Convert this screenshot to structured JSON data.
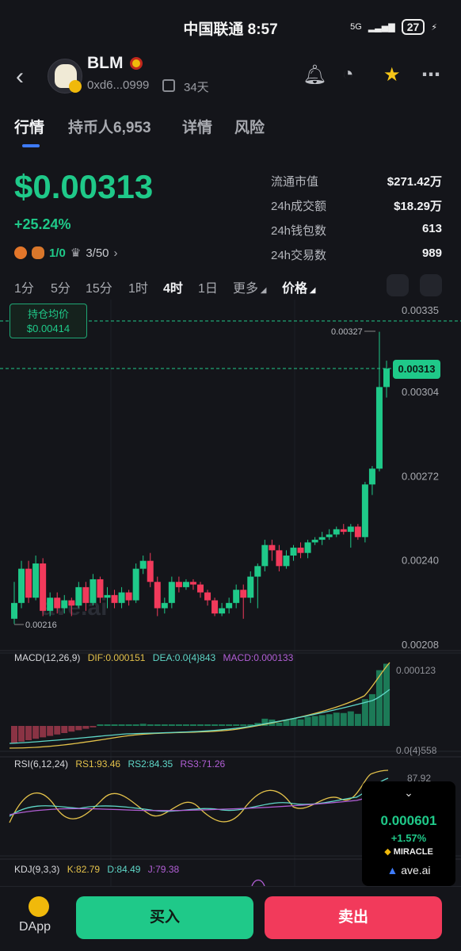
{
  "status": {
    "carrier_time": "中国联通 8:57",
    "network": "5G",
    "battery": "27"
  },
  "header": {
    "token": "BLM",
    "address": "0xd6...0999",
    "age": "34天"
  },
  "tabs": [
    "行情",
    "持币人6,953",
    "详情",
    "风险"
  ],
  "price": {
    "value": "$0.00313",
    "change": "+25.24%"
  },
  "tags": {
    "holders": "1/0",
    "rank": "3/50"
  },
  "stats": [
    {
      "label": "流通市值",
      "value": "$271.42万"
    },
    {
      "label": "24h成交额",
      "value": "$18.29万"
    },
    {
      "label": "24h钱包数",
      "value": "613"
    },
    {
      "label": "24h交易数",
      "value": "989"
    }
  ],
  "timeframes": [
    "1分",
    "5分",
    "15分",
    "1时",
    "4时",
    "1日",
    "更多",
    "价格"
  ],
  "active_timeframe": "4时",
  "chart": {
    "avg_label": "持仓均价",
    "avg_value": "$0.00414",
    "current_tag": "0.00313",
    "high_label": "0.00327",
    "low_label": "0.00216",
    "watermark": "ave.ai"
  },
  "chart_data": {
    "type": "candlestick",
    "y_ticks": [
      "0.00335",
      "0.00304",
      "0.00272",
      "0.00240",
      "0.00208"
    ],
    "ylim": [
      0.00208,
      0.00335
    ],
    "candles": [
      [
        0.00218,
        0.00224,
        0.00232,
        0.00216
      ],
      [
        0.00224,
        0.00237,
        0.0024,
        0.00222
      ],
      [
        0.00237,
        0.00226,
        0.0024,
        0.00224
      ],
      [
        0.00226,
        0.00239,
        0.00242,
        0.00225
      ],
      [
        0.00239,
        0.00221,
        0.00241,
        0.00219
      ],
      [
        0.00221,
        0.00226,
        0.00228,
        0.00219
      ],
      [
        0.00226,
        0.00222,
        0.00228,
        0.0022
      ],
      [
        0.00222,
        0.00225,
        0.00227,
        0.0022
      ],
      [
        0.00225,
        0.00223,
        0.00226,
        0.00219
      ],
      [
        0.00223,
        0.0023,
        0.00232,
        0.00222
      ],
      [
        0.0023,
        0.00224,
        0.00232,
        0.00221
      ],
      [
        0.00224,
        0.00233,
        0.00235,
        0.00223
      ],
      [
        0.00233,
        0.00226,
        0.00234,
        0.00224
      ],
      [
        0.00226,
        0.00227,
        0.0023,
        0.00222
      ],
      [
        0.00227,
        0.00224,
        0.00229,
        0.00222
      ],
      [
        0.00224,
        0.00228,
        0.0023,
        0.00222
      ],
      [
        0.00228,
        0.00225,
        0.00229,
        0.00223
      ],
      [
        0.00225,
        0.00237,
        0.00239,
        0.00224
      ],
      [
        0.00237,
        0.0024,
        0.00242,
        0.00235
      ],
      [
        0.0024,
        0.00232,
        0.00243,
        0.0023
      ],
      [
        0.00232,
        0.00222,
        0.00234,
        0.00219
      ],
      [
        0.00222,
        0.00224,
        0.00226,
        0.0022
      ],
      [
        0.00224,
        0.00232,
        0.00234,
        0.00222
      ],
      [
        0.00232,
        0.0023,
        0.00234,
        0.00228
      ],
      [
        0.0023,
        0.00232,
        0.00233,
        0.00229
      ],
      [
        0.00232,
        0.00231,
        0.00233,
        0.00229
      ],
      [
        0.00231,
        0.00228,
        0.00232,
        0.00226
      ],
      [
        0.00228,
        0.00225,
        0.00229,
        0.00223
      ],
      [
        0.00225,
        0.0022,
        0.00226,
        0.00219
      ],
      [
        0.0022,
        0.00222,
        0.00224,
        0.00219
      ],
      [
        0.00222,
        0.00224,
        0.00226,
        0.0022
      ],
      [
        0.00224,
        0.00229,
        0.00231,
        0.00222
      ],
      [
        0.00229,
        0.00226,
        0.00231,
        0.00218
      ],
      [
        0.00226,
        0.00234,
        0.00236,
        0.00224
      ],
      [
        0.00234,
        0.00238,
        0.00239,
        0.00222
      ],
      [
        0.00238,
        0.00246,
        0.00248,
        0.00236
      ],
      [
        0.00246,
        0.00244,
        0.00248,
        0.0024
      ],
      [
        0.00244,
        0.00238,
        0.00246,
        0.00236
      ],
      [
        0.00238,
        0.00242,
        0.00244,
        0.00237
      ],
      [
        0.00242,
        0.00245,
        0.00246,
        0.0024
      ],
      [
        0.00245,
        0.00243,
        0.00247,
        0.00241
      ],
      [
        0.00243,
        0.00247,
        0.00248,
        0.00241
      ],
      [
        0.00247,
        0.00248,
        0.00249,
        0.00246
      ],
      [
        0.00248,
        0.00249,
        0.00251,
        0.00246
      ],
      [
        0.00249,
        0.0025,
        0.00252,
        0.00248
      ],
      [
        0.0025,
        0.00252,
        0.00253,
        0.00249
      ],
      [
        0.00252,
        0.00251,
        0.00254,
        0.0025
      ],
      [
        0.00251,
        0.00253,
        0.00254,
        0.00245
      ],
      [
        0.00253,
        0.00249,
        0.00254,
        0.00248
      ],
      [
        0.00249,
        0.00269,
        0.0027,
        0.00247
      ],
      [
        0.00269,
        0.00275,
        0.00276,
        0.00265
      ],
      [
        0.00275,
        0.00306,
        0.00327,
        0.00274
      ],
      [
        0.00306,
        0.00313,
        0.00316,
        0.00302
      ]
    ]
  },
  "macd": {
    "label": "MACD(12,26,9)",
    "dif": "DIF:0.000151",
    "dea": "DEA:0.0{4}843",
    "macd": "MACD:0.000133",
    "top": "0.000123",
    "bottom": "0.0{4}558"
  },
  "rsi": {
    "label": "RSI(6,12,24)",
    "rs1": "RS1:93.46",
    "rs2": "RS2:84.35",
    "rs3": "RS3:71.26",
    "top": "87.92"
  },
  "kdj": {
    "label": "KDJ(9,3,3)",
    "k": "K:82.79",
    "d": "D:84.49",
    "j": "J:79.38"
  },
  "float_card": {
    "price": "0.000601",
    "change": "+1.57%",
    "name": "MIRACLE",
    "brand": "ave.ai"
  },
  "bottom": {
    "dapp": "DApp",
    "buy": "买入",
    "sell": "卖出"
  },
  "colors": {
    "up": "#1fc989",
    "down": "#f23a5b",
    "accent": "#3e7bfa"
  }
}
